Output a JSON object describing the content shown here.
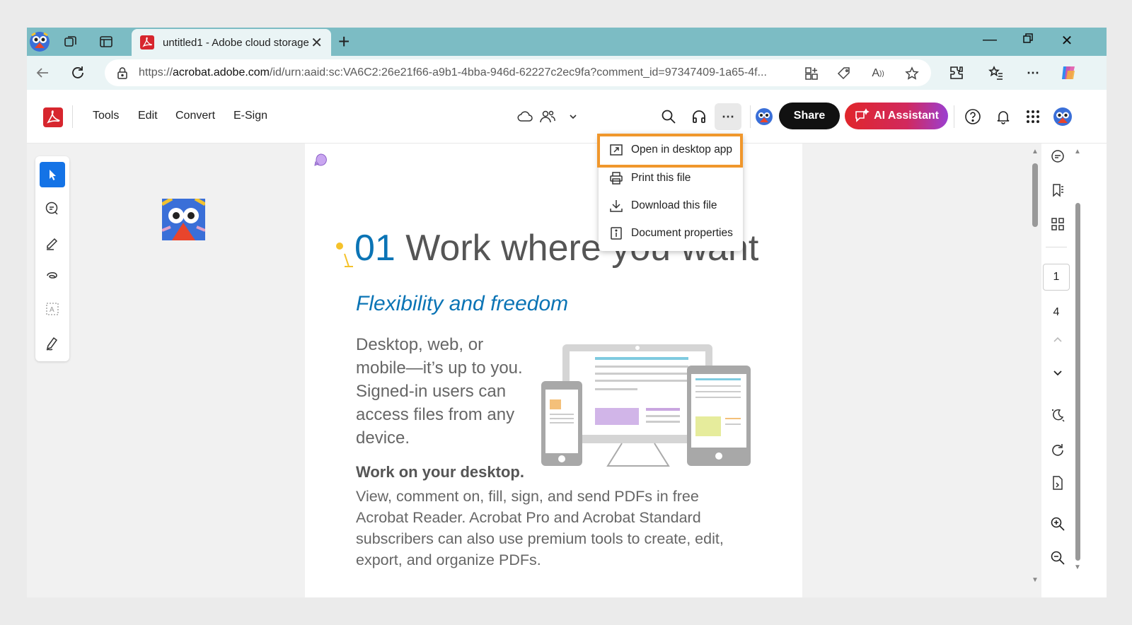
{
  "browser": {
    "tab_title": "untitled1 - Adobe cloud storage",
    "url_prefix": "https://",
    "url_host": "acrobat.adobe.com",
    "url_rest": "/id/urn:aaid:sc:VA6C2:26e21f66-a9b1-4bba-946d-62227c2ec9fa?comment_id=97347409-1a65-4f..."
  },
  "toolbar": {
    "menu": [
      "Tools",
      "Edit",
      "Convert",
      "E-Sign"
    ],
    "share_label": "Share",
    "ai_label": "AI Assistant",
    "more_label": "⋯"
  },
  "dropdown": {
    "items": [
      {
        "label": "Open in desktop app",
        "icon": "open-external-icon"
      },
      {
        "label": "Print this file",
        "icon": "printer-icon"
      },
      {
        "label": "Download this file",
        "icon": "download-icon"
      },
      {
        "label": "Document properties",
        "icon": "info-icon"
      }
    ]
  },
  "document": {
    "heading_num": "01",
    "heading_text": " Work where you want",
    "subheading": "Flexibility and freedom",
    "paragraph": "Desktop, web, or mobile—it’s up to you. Signed-in users can access files from any device.",
    "bold_heading": "Work on your desktop.",
    "paragraph2": "View, comment on, fill, sign, and send PDFs in free Acrobat Reader. Acrobat Pro and Acrobat Standard subscribers can also use premium tools to create, edit, export, and organize PDFs."
  },
  "pagination": {
    "current": "1",
    "total": "4"
  },
  "colors": {
    "tabbar": "#7cbcc4",
    "accent_blue": "#0b74b5",
    "highlight_orange": "#f0972c",
    "acrobat_red": "#d7262e"
  }
}
